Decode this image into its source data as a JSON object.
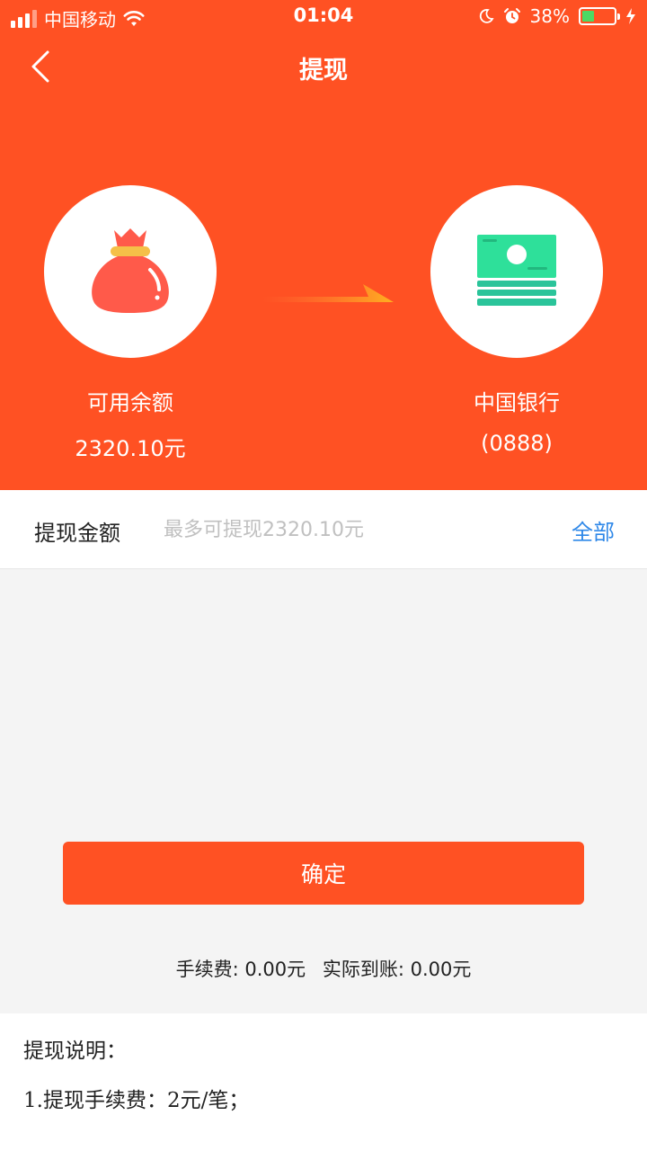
{
  "status_bar": {
    "carrier": "中国移动",
    "time": "01:04",
    "battery_percent": "38%",
    "battery_level": 0.38
  },
  "nav": {
    "title": "提现"
  },
  "hero": {
    "source_label": "可用余额",
    "source_amount": "2320.10元",
    "target_label": "中国银行",
    "target_account": "(0888)"
  },
  "amount": {
    "label": "提现金额",
    "placeholder": "最多可提现2320.10元",
    "value": "",
    "all_label": "全部"
  },
  "confirm_label": "确定",
  "fees": {
    "fee": "手续费: 0.00元",
    "actual": "实际到账: 0.00元"
  },
  "notes": {
    "title": "提现说明：",
    "items": [
      "1.提现手续费：2元/笔；"
    ]
  },
  "colors": {
    "primary": "#ff5123",
    "link": "#2f88e8",
    "bag": "#ff5a4a",
    "bag_band": "#f5c048",
    "money": "#2ee09a"
  }
}
